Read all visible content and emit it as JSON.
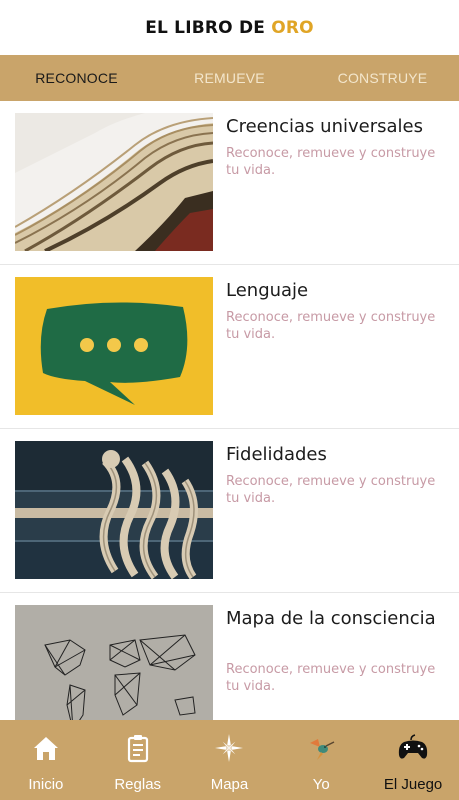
{
  "header": {
    "title_main": "EL LIBRO DE ",
    "title_accent": "ORO"
  },
  "tabs": [
    {
      "label": "RECONOCE",
      "active": true
    },
    {
      "label": "REMUEVE",
      "active": false
    },
    {
      "label": "CONSTRUYE",
      "active": false
    }
  ],
  "cards": [
    {
      "title": "Creencias universales",
      "subtitle": "Reconoce, remueve y construye tu vida.",
      "image": "open-book-pages"
    },
    {
      "title": "Lenguaje",
      "subtitle": "Reconoce, remueve y construye tu vida.",
      "image": "speech-bubble-yellow"
    },
    {
      "title": "Fidelidades",
      "subtitle": "Reconoce, remueve y construye tu vida.",
      "image": "rope-knot"
    },
    {
      "title": "Mapa de la consciencia",
      "subtitle": "Reconoce, remueve y construye tu vida.",
      "image": "world-map-geometric"
    }
  ],
  "bottom_nav": [
    {
      "label": "Inicio",
      "icon": "home-icon",
      "active": false
    },
    {
      "label": "Reglas",
      "icon": "clipboard-icon",
      "active": false
    },
    {
      "label": "Mapa",
      "icon": "compass-rose-icon",
      "active": false
    },
    {
      "label": "Yo",
      "icon": "hummingbird-icon",
      "active": false
    },
    {
      "label": "El Juego",
      "icon": "gamepad-icon",
      "active": true
    }
  ],
  "colors": {
    "accent": "#e0a526",
    "bar": "#c9a46a",
    "subtitle": "#c79aa5"
  }
}
